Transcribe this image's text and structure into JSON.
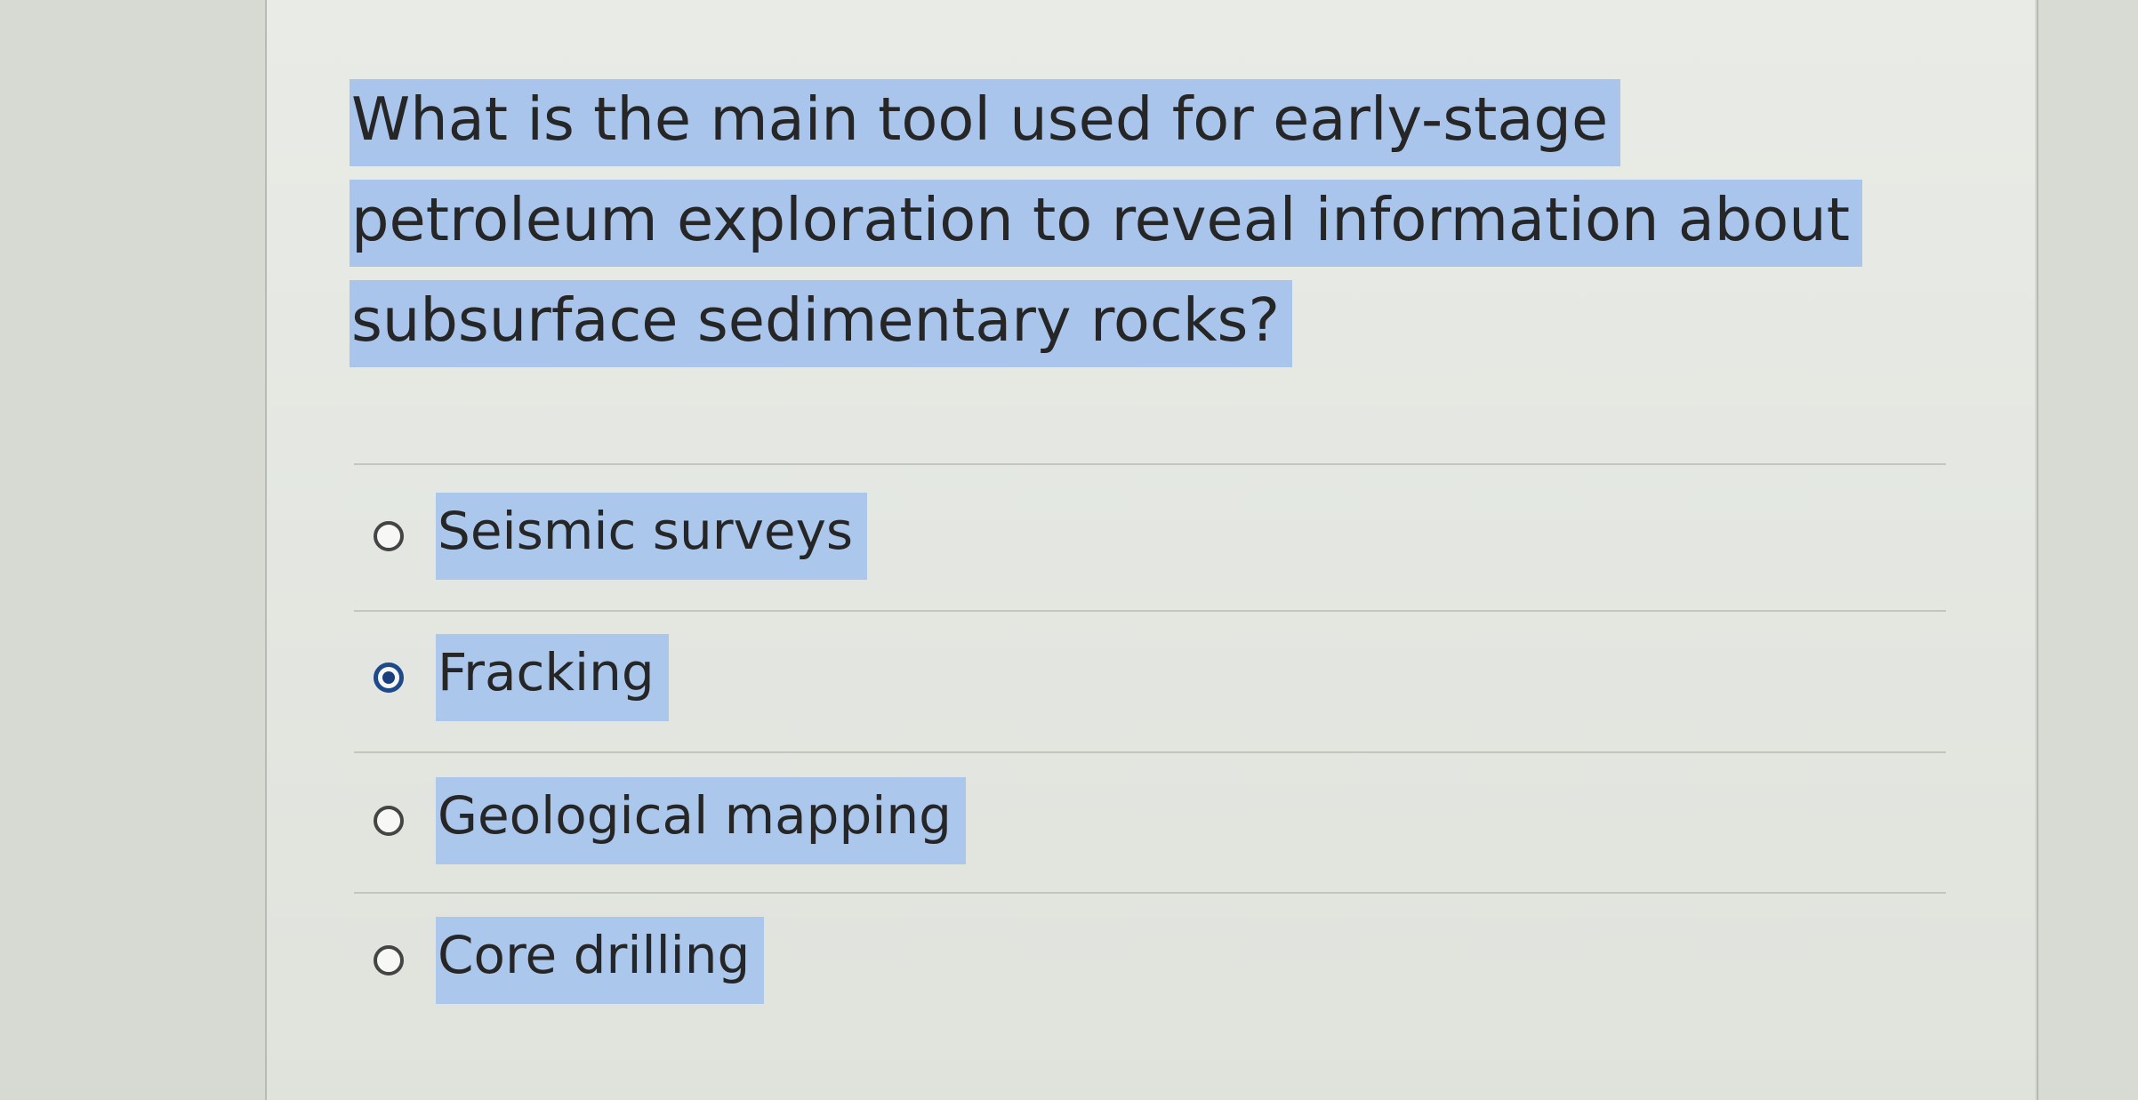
{
  "question": {
    "text": "What is the main tool used for early-stage petroleum exploration to reveal information about subsurface sedimentary rocks?"
  },
  "options": [
    {
      "label": "Seismic surveys",
      "selected": false
    },
    {
      "label": "Fracking",
      "selected": true
    },
    {
      "label": "Geological mapping",
      "selected": false
    },
    {
      "label": "Core drilling",
      "selected": false
    }
  ],
  "colors": {
    "highlight": "#a9c5ec",
    "radio_selected": "#1a3f7e",
    "text": "#262626"
  }
}
